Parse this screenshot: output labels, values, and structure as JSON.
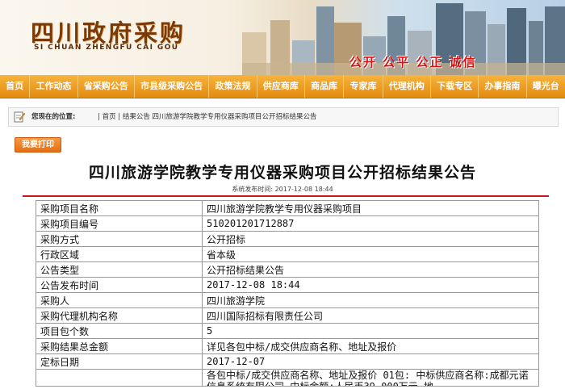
{
  "banner": {
    "title": "四川政府采购",
    "pinyin": "SI CHUAN ZHENGFU CAI GOU",
    "slogan": "公开 公平 公正 诚信"
  },
  "nav": {
    "items": [
      "首页",
      "工作动态",
      "省采购公告",
      "市县级采购公告",
      "政策法规",
      "供应商库",
      "商品库",
      "专家库",
      "代理机构",
      "下载专区",
      "办事指南",
      "曝光台"
    ]
  },
  "location": {
    "label": "您现在的位置:",
    "path": "| 首页 | 结果公告 四川旅游学院教学专用仪器采购项目公开招标结果公告"
  },
  "print_label": "我要打印",
  "doc": {
    "title": "四川旅游学院教学专用仪器采购项目公开招标结果公告",
    "publish_time": "系统发布时间: 2017-12-08 18:44"
  },
  "table": {
    "rows": [
      {
        "k": "采购项目名称",
        "v": "四川旅游学院教学专用仪器采购项目"
      },
      {
        "k": "采购项目编号",
        "v": "510201201712887"
      },
      {
        "k": "采购方式",
        "v": "公开招标"
      },
      {
        "k": "行政区域",
        "v": "省本级"
      },
      {
        "k": "公告类型",
        "v": "公开招标结果公告"
      },
      {
        "k": "公告发布时间",
        "v": "2017-12-08 18:44"
      },
      {
        "k": "采购人",
        "v": "四川旅游学院"
      },
      {
        "k": "采购代理机构名称",
        "v": "四川国际招标有限责任公司"
      },
      {
        "k": "项目包个数",
        "v": "5"
      },
      {
        "k": "采购结果总金额",
        "v": "详见各包中标/成交供应商名称、地址及报价"
      },
      {
        "k": "定标日期",
        "v": "2017-12-07"
      }
    ],
    "long_value": "各包中标/成交供应商名称、地址及报价 01包: 中标供应商名称:成都元诺信息系统有限公司,中标金额:人民币39.000万元,地"
  },
  "colors": {
    "nav": "#e38a10",
    "rule": "#c8161d",
    "title_brown": "#7a3a08",
    "slogan_red": "#d61212"
  }
}
